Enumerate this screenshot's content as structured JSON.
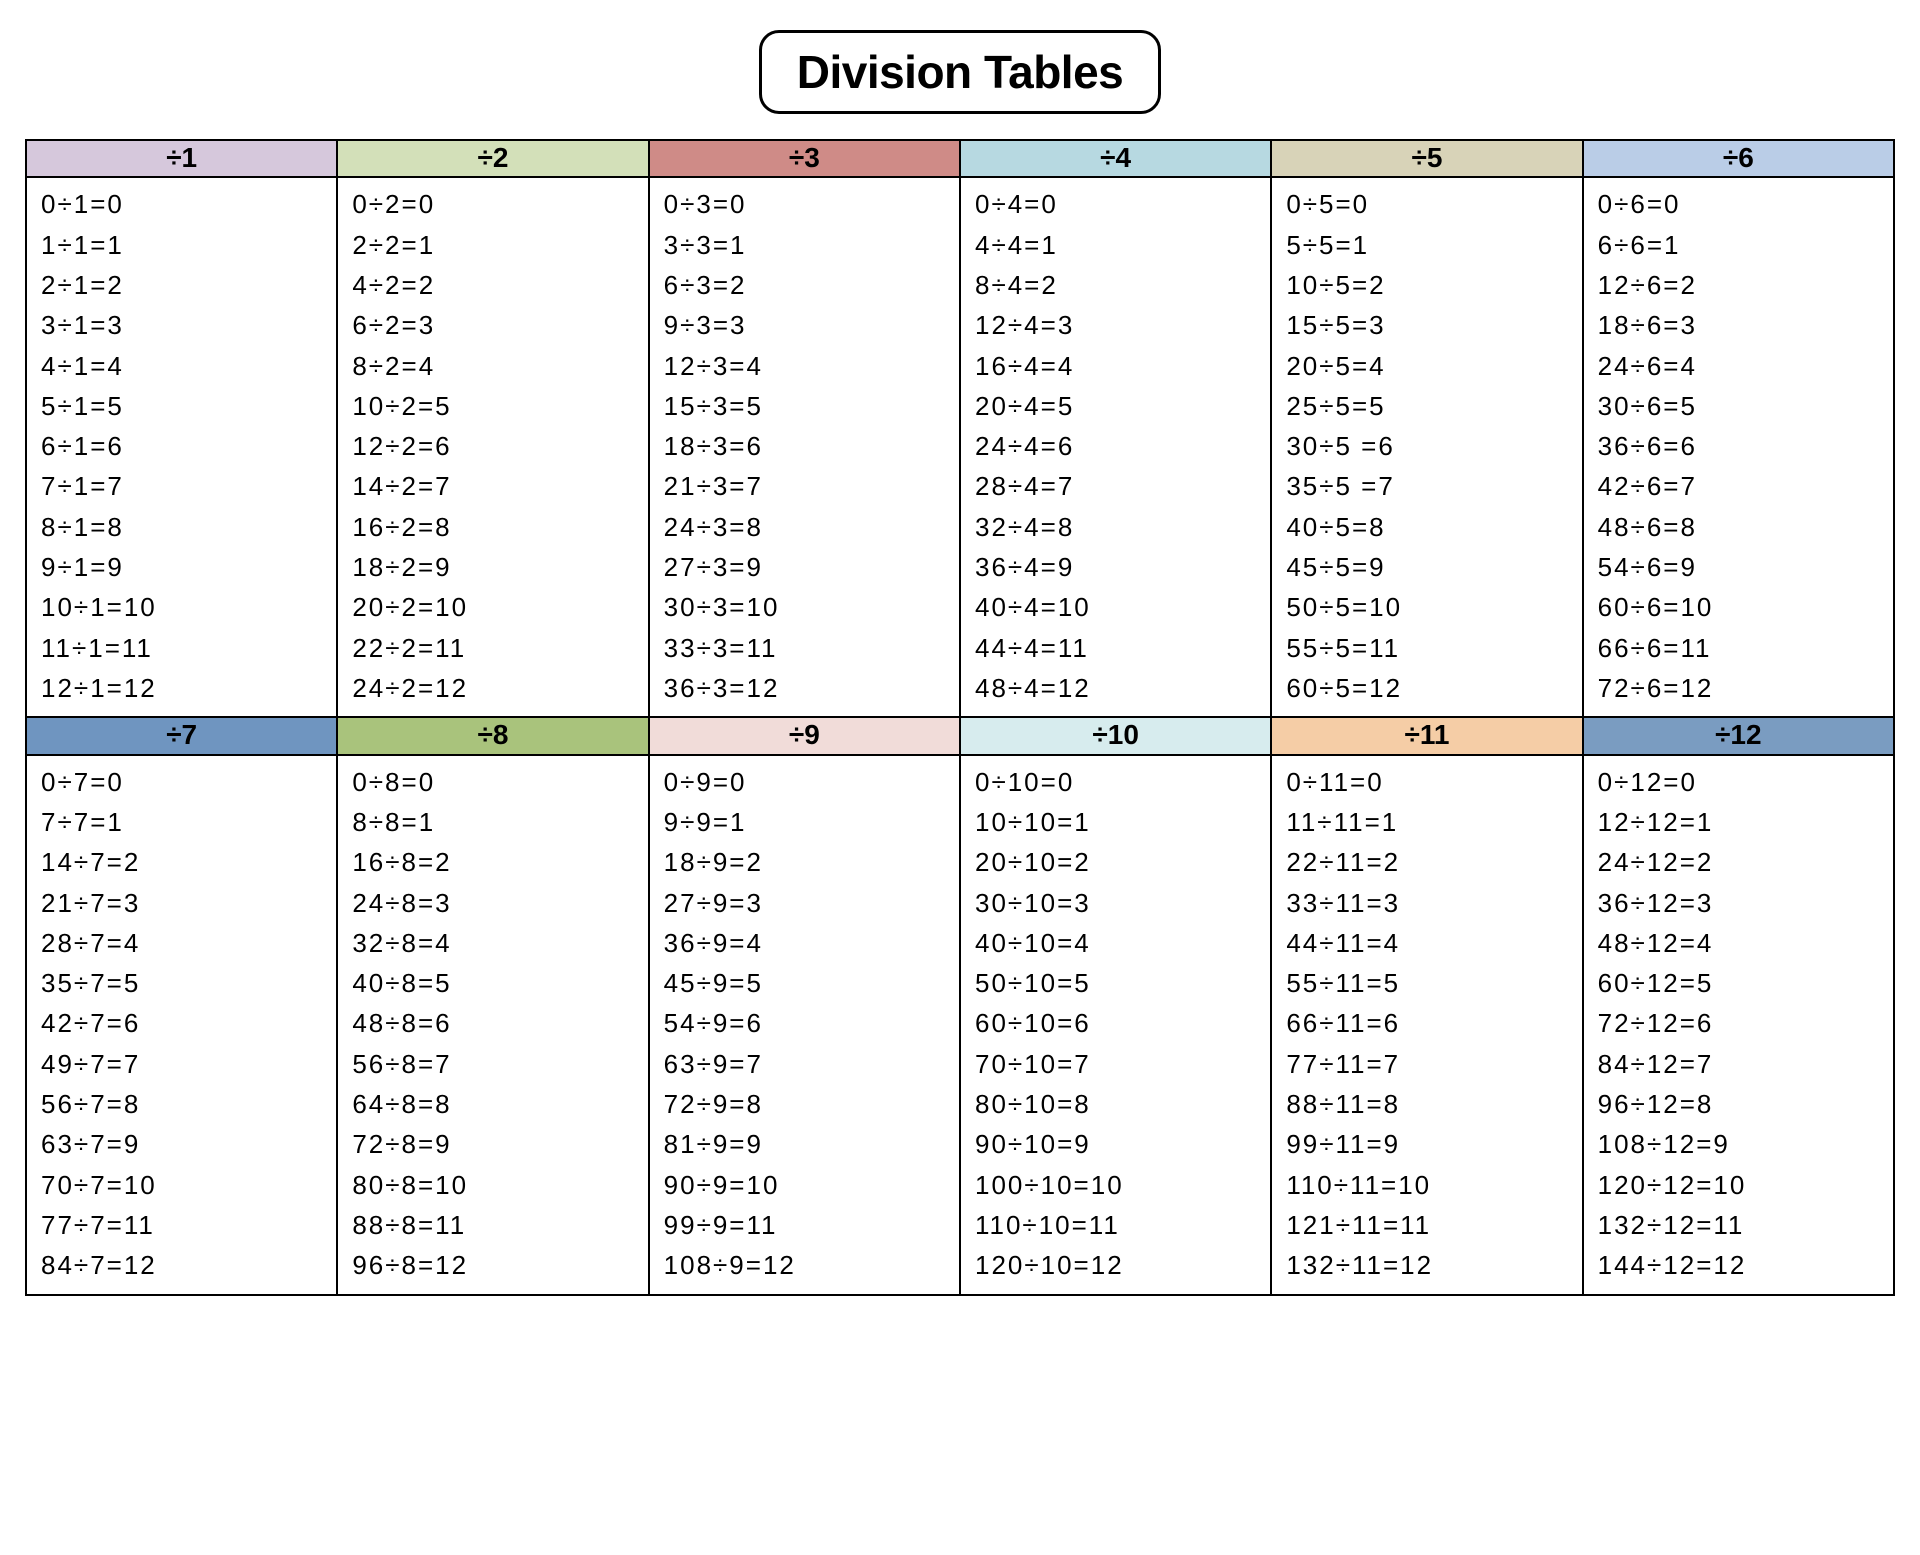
{
  "title": "Division Tables",
  "tables": [
    {
      "header": "÷1",
      "color": "#d6c8dc",
      "rows": [
        "0÷1=0",
        "1÷1=1",
        "2÷1=2",
        "3÷1=3",
        "4÷1=4",
        "5÷1=5",
        "6÷1=6",
        "7÷1=7",
        "8÷1=8",
        "9÷1=9",
        "10÷1=10",
        "11÷1=11",
        "12÷1=12"
      ]
    },
    {
      "header": "÷2",
      "color": "#d3e0b9",
      "rows": [
        "0÷2=0",
        "2÷2=1",
        "4÷2=2",
        "6÷2=3",
        "8÷2=4",
        "10÷2=5",
        "12÷2=6",
        "14÷2=7",
        "16÷2=8",
        "18÷2=9",
        "20÷2=10",
        "22÷2=11",
        "24÷2=12"
      ]
    },
    {
      "header": "÷3",
      "color": "#cf8b87",
      "rows": [
        "0÷3=0",
        "3÷3=1",
        "6÷3=2",
        "9÷3=3",
        "12÷3=4",
        "15÷3=5",
        "18÷3=6",
        "21÷3=7",
        "24÷3=8",
        "27÷3=9",
        "30÷3=10",
        "33÷3=11",
        "36÷3=12"
      ]
    },
    {
      "header": "÷4",
      "color": "#b7d9e1",
      "rows": [
        "0÷4=0",
        "4÷4=1",
        "8÷4=2",
        "12÷4=3",
        "16÷4=4",
        "20÷4=5",
        "24÷4=6",
        "28÷4=7",
        "32÷4=8",
        "36÷4=9",
        "40÷4=10",
        "44÷4=11",
        "48÷4=12"
      ]
    },
    {
      "header": "÷5",
      "color": "#d8d3b8",
      "rows": [
        "0÷5=0",
        "5÷5=1",
        "10÷5=2",
        "15÷5=3",
        "20÷5=4",
        "25÷5=5",
        "30÷5 =6",
        "35÷5 =7",
        "40÷5=8",
        "45÷5=9",
        "50÷5=10",
        "55÷5=11",
        "60÷5=12"
      ]
    },
    {
      "header": "÷6",
      "color": "#bacde7",
      "rows": [
        "0÷6=0",
        "6÷6=1",
        "12÷6=2",
        "18÷6=3",
        "24÷6=4",
        "30÷6=5",
        "36÷6=6",
        "42÷6=7",
        "48÷6=8",
        "54÷6=9",
        "60÷6=10",
        "66÷6=11",
        "72÷6=12"
      ]
    },
    {
      "header": "÷7",
      "color": "#6f95c0",
      "rows": [
        "0÷7=0",
        "7÷7=1",
        "14÷7=2",
        "21÷7=3",
        "28÷7=4",
        "35÷7=5",
        "42÷7=6",
        "49÷7=7",
        "56÷7=8",
        "63÷7=9",
        "70÷7=10",
        "77÷7=11",
        "84÷7=12"
      ]
    },
    {
      "header": "÷8",
      "color": "#a9c37c",
      "rows": [
        "0÷8=0",
        "8÷8=1",
        "16÷8=2",
        "24÷8=3",
        "32÷8=4",
        "40÷8=5",
        "48÷8=6",
        "56÷8=7",
        "64÷8=8",
        "72÷8=9",
        "80÷8=10",
        "88÷8=11",
        "96÷8=12"
      ]
    },
    {
      "header": "÷9",
      "color": "#f1dcd9",
      "rows": [
        "0÷9=0",
        "9÷9=1",
        "18÷9=2",
        "27÷9=3",
        "36÷9=4",
        "45÷9=5",
        "54÷9=6",
        "63÷9=7",
        "72÷9=8",
        "81÷9=9",
        "90÷9=10",
        "99÷9=11",
        "108÷9=12"
      ]
    },
    {
      "header": "÷10",
      "color": "#d7ecee",
      "rows": [
        "0÷10=0",
        "10÷10=1",
        "20÷10=2",
        "30÷10=3",
        "40÷10=4",
        "50÷10=5",
        "60÷10=6",
        "70÷10=7",
        "80÷10=8",
        "90÷10=9",
        "100÷10=10",
        "110÷10=11",
        "120÷10=12"
      ]
    },
    {
      "header": "÷11",
      "color": "#f5cda6",
      "rows": [
        "0÷11=0",
        "11÷11=1",
        "22÷11=2",
        "33÷11=3",
        "44÷11=4",
        "55÷11=5",
        "66÷11=6",
        "77÷11=7",
        "88÷11=8",
        "99÷11=9",
        "110÷11=10",
        "121÷11=11",
        "132÷11=12"
      ]
    },
    {
      "header": "÷12",
      "color": "#7a9cc1",
      "rows": [
        "0÷12=0",
        "12÷12=1",
        "24÷12=2",
        "36÷12=3",
        "48÷12=4",
        "60÷12=5",
        "72÷12=6",
        "84÷12=7",
        "96÷12=8",
        "108÷12=9",
        "120÷12=10",
        "132÷12=11",
        "144÷12=12"
      ]
    }
  ]
}
